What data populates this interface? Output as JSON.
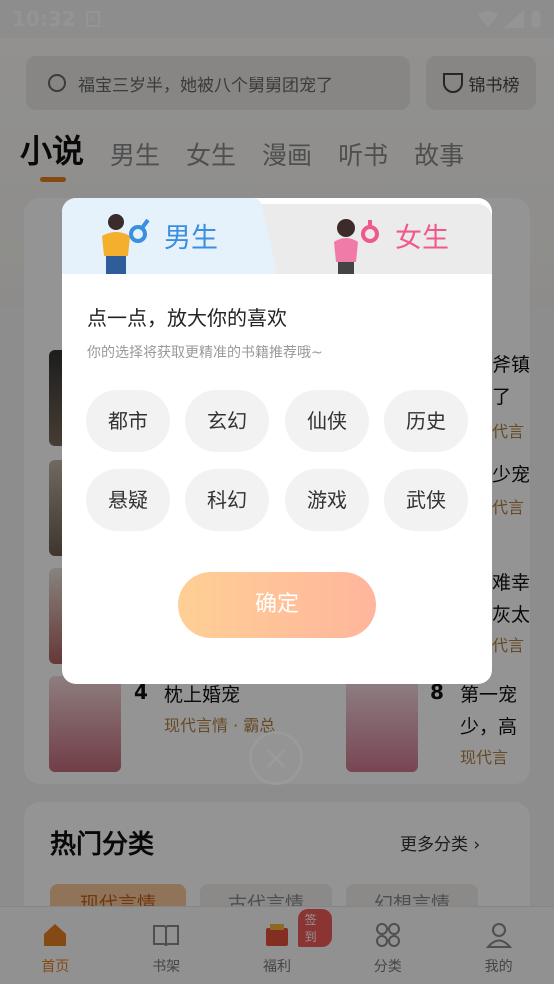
{
  "status_bar": {
    "time": "10:32",
    "notification": "A"
  },
  "search": {
    "placeholder": "福宝三岁半，她被八个舅舅团宠了"
  },
  "rank_button": {
    "label": "锦书榜"
  },
  "category_tabs": [
    {
      "label": "小说",
      "active": true
    },
    {
      "label": "男生"
    },
    {
      "label": "女生"
    },
    {
      "label": "漫画"
    },
    {
      "label": "听书"
    },
    {
      "label": "故事"
    }
  ],
  "books": [
    {
      "rank": "4",
      "title": "枕上婚宠",
      "meta": "现代言情 · 霸总"
    },
    {
      "rank": "8",
      "title": "第一宠",
      "meta": "现代言"
    }
  ],
  "book_fragments": [
    "斧镇",
    "了",
    "代言",
    "少宠",
    "代言",
    "难幸",
    "灰太",
    "代言",
    "少，高"
  ],
  "hot_section": {
    "title": "热门分类",
    "more": "更多分类"
  },
  "hot_chips": [
    "现代言情",
    "古代言情",
    "幻想言情"
  ],
  "bottom_nav": [
    {
      "label": "首页",
      "icon": "home-icon",
      "active": true
    },
    {
      "label": "书架",
      "icon": "bookshelf-icon"
    },
    {
      "label": "福利",
      "icon": "gift-icon",
      "badge": "签到"
    },
    {
      "label": "分类",
      "icon": "category-icon"
    },
    {
      "label": "我的",
      "icon": "profile-icon"
    }
  ],
  "dialog": {
    "tabs": [
      {
        "label": "男生",
        "selected": true
      },
      {
        "label": "女生"
      }
    ],
    "title": "点一点，放大你的喜欢",
    "subtitle": "你的选择将获取更精准的书籍推荐哦~",
    "genres": [
      "都市",
      "玄幻",
      "仙侠",
      "历史",
      "悬疑",
      "科幻",
      "游戏",
      "武侠"
    ],
    "confirm": "确定"
  },
  "colors": {
    "accent": "#e67e22",
    "male": "#3a8fe0",
    "female": "#f05a8a",
    "confirm_start": "#ffcf95",
    "confirm_end": "#ffb59c"
  }
}
